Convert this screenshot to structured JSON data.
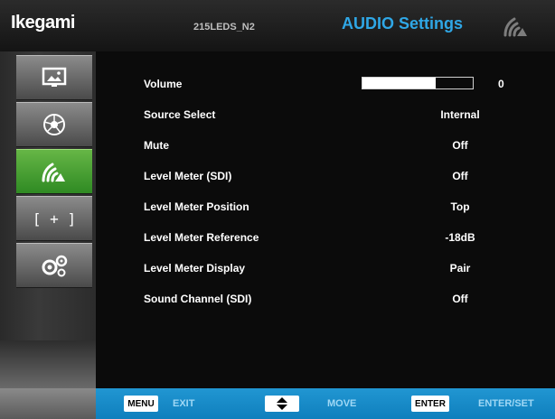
{
  "header": {
    "brand": "Ikegami",
    "model": "215LEDS_N2",
    "title": "AUDIO Settings",
    "title_icon": "audio-icon"
  },
  "sidebar": {
    "items": [
      {
        "name": "picture",
        "icon": "picture-icon",
        "active": false
      },
      {
        "name": "color",
        "icon": "color-wheel-icon",
        "active": false
      },
      {
        "name": "audio",
        "icon": "audio-icon",
        "active": true
      },
      {
        "name": "marker",
        "icon": "marker-icon",
        "active": false
      },
      {
        "name": "system",
        "icon": "gears-icon",
        "active": false
      }
    ],
    "marker_glyph": "[ + ]"
  },
  "settings": {
    "volume": {
      "label": "Volume",
      "value": "0",
      "level": 0.66
    },
    "rows": [
      {
        "label": "Source Select",
        "value": "Internal"
      },
      {
        "label": "Mute",
        "value": "Off"
      },
      {
        "label": "Level Meter (SDI)",
        "value": "Off"
      },
      {
        "label": "Level Meter Position",
        "value": "Top"
      },
      {
        "label": "Level Meter Reference",
        "value": "-18dB"
      },
      {
        "label": "Level Meter Display",
        "value": "Pair"
      },
      {
        "label": "Sound Channel (SDI)",
        "value": "Off"
      }
    ]
  },
  "footer": {
    "menu_key": "MENU",
    "menu_action": "EXIT",
    "move_key": "up-down-arrow-icon",
    "move_action": "MOVE",
    "enter_key": "ENTER",
    "enter_action": "ENTER/SET"
  },
  "colors": {
    "title": "#2fa7e6",
    "active_tab": "#4ea83a",
    "footer": "#1a8fcd"
  }
}
